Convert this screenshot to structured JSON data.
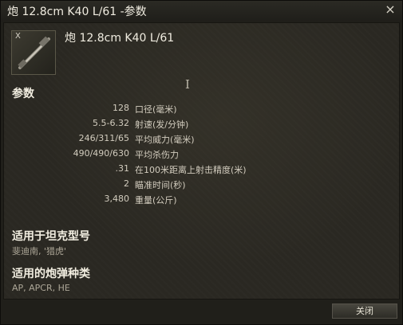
{
  "window": {
    "title": "炮 12.8cm K40 L/61 -参数",
    "close_icon": "×"
  },
  "gun": {
    "icon": "gun-icon",
    "badge": "X",
    "name": "炮 12.8cm K40 L/61"
  },
  "cursor": {
    "glyph": "I"
  },
  "params": {
    "heading": "参数",
    "rows": [
      {
        "value": "128",
        "label": "口径(毫米)"
      },
      {
        "value": "5.5-6.32",
        "label": "射速(发/分钟)"
      },
      {
        "value": "246/311/65",
        "label": "平均威力(毫米)"
      },
      {
        "value": "490/490/630",
        "label": "平均杀伤力"
      },
      {
        "value": ".31",
        "label": "在100米距离上射击精度(米)"
      },
      {
        "value": "2",
        "label": "瞄准时间(秒)"
      },
      {
        "value": "3,480",
        "label": "重量(公斤)"
      }
    ]
  },
  "tanks": {
    "heading": "适用于坦克型号",
    "value": "斐迪南, '猎虎'"
  },
  "ammo": {
    "heading": "适用的炮弹种类",
    "value": "AP, APCR, HE"
  },
  "footer": {
    "close_label": "关闭"
  }
}
